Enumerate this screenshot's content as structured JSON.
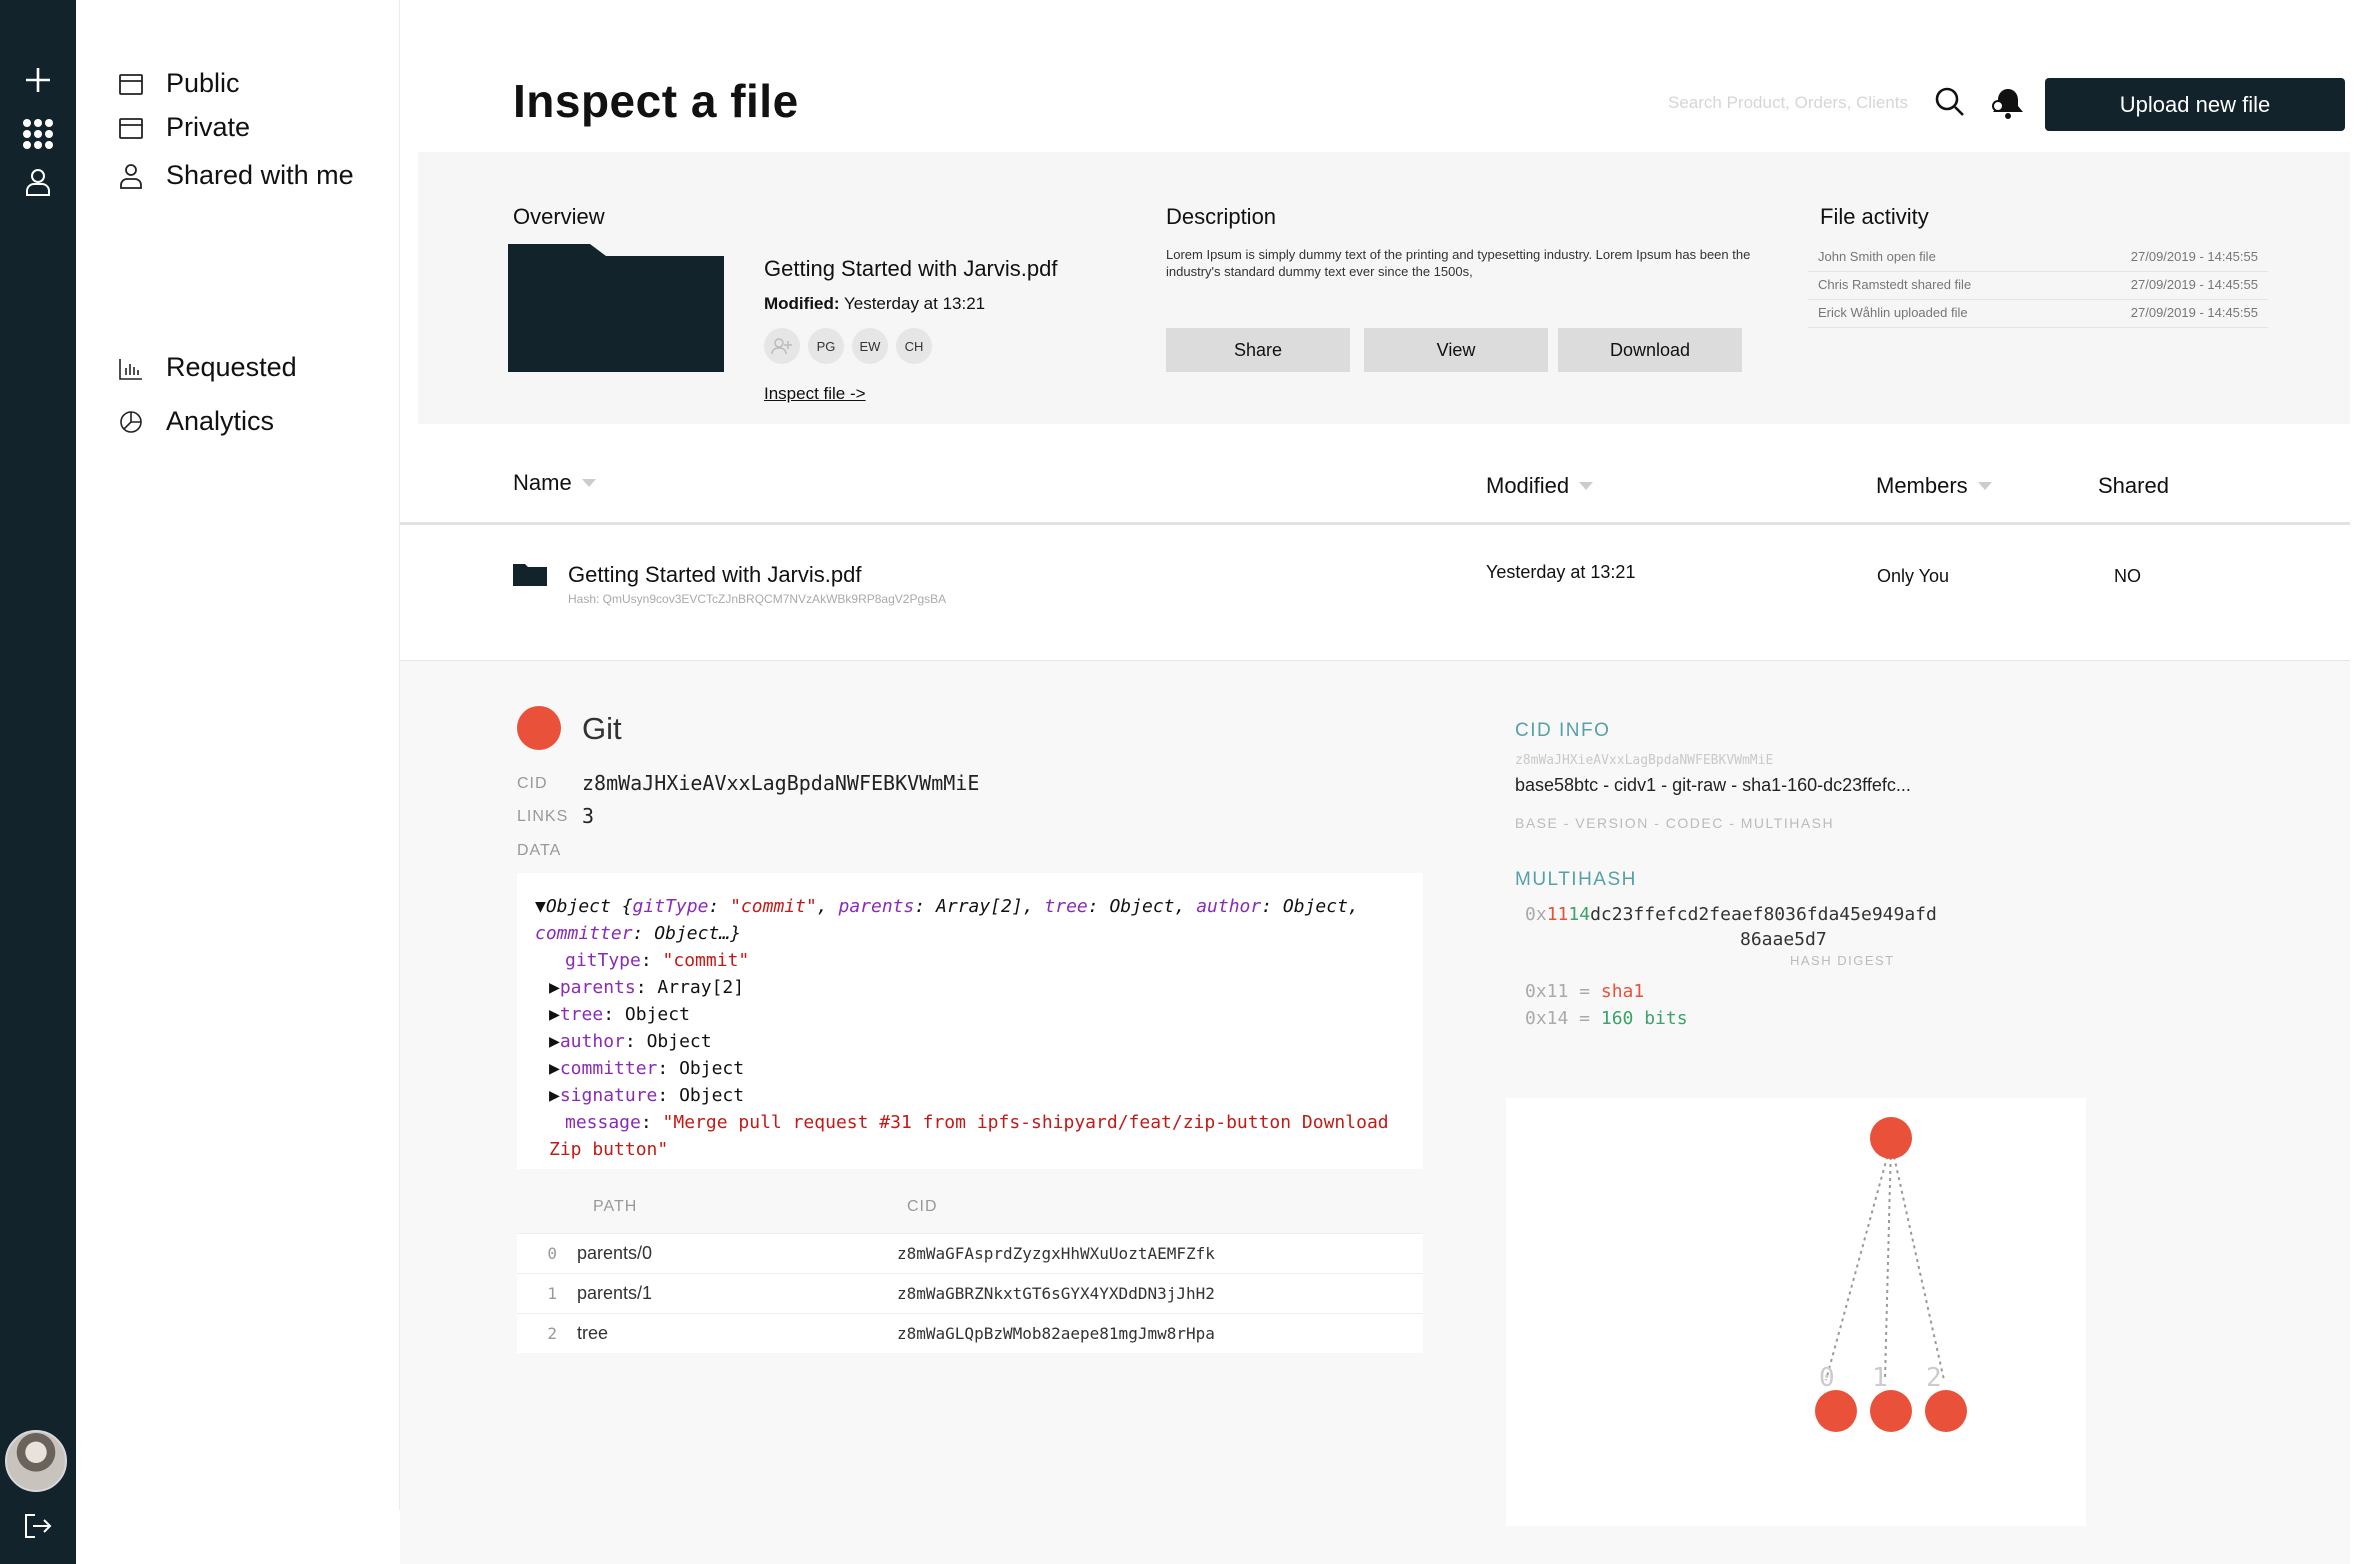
{
  "rail": {
    "icons": [
      "plus-icon",
      "apps-grid-icon",
      "user-icon",
      "logout-icon"
    ]
  },
  "sidebar": {
    "items": [
      {
        "label": "Public",
        "icon": "calendar-icon"
      },
      {
        "label": "Private",
        "icon": "calendar-icon"
      },
      {
        "label": "Shared with me",
        "icon": "user-icon"
      },
      {
        "label": "Requested",
        "icon": "bar-chart-icon"
      },
      {
        "label": "Analytics",
        "icon": "pie-chart-icon"
      }
    ]
  },
  "header": {
    "title": "Inspect a file",
    "search_placeholder": "Search Product, Orders, Clients",
    "upload_label": "Upload new file"
  },
  "overview": {
    "label": "Overview",
    "file_name": "Getting Started with Jarvis.pdf",
    "modified_key": "Modified:",
    "modified_value": "Yesterday at 13:21",
    "members": [
      "PG",
      "EW",
      "CH"
    ],
    "inspect_link": "Inspect file ->",
    "description_label": "Description",
    "description": "Lorem Ipsum is simply dummy text of the printing and typesetting industry. Lorem Ipsum has been the industry's standard dummy text ever since the 1500s,",
    "buttons": {
      "share": "Share",
      "view": "View",
      "download": "Download"
    },
    "activity_label": "File activity",
    "activity": [
      {
        "text": "John Smith open file",
        "time": "27/09/2019 - 14:45:55"
      },
      {
        "text": "Chris Ramstedt shared file",
        "time": "27/09/2019 - 14:45:55"
      },
      {
        "text": "Erick Wåhlin uploaded file",
        "time": "27/09/2019 - 14:45:55"
      }
    ]
  },
  "table": {
    "headers": {
      "name": "Name",
      "modified": "Modified",
      "members": "Members",
      "shared": "Shared"
    },
    "rows": [
      {
        "name": "Getting Started with Jarvis.pdf",
        "hash": "Hash: QmUsyn9cov3EVCTcZJnBRQCM7NVzAkWBk9RP8agV2PgsBA",
        "modified": "Yesterday at 13:21",
        "members": "Only You",
        "shared": "NO"
      }
    ]
  },
  "inspector": {
    "codec": "Git",
    "cid_key": "CID",
    "cid_value": "z8mWaJHXieAVxxLagBpdaNWFEBKVWmMiE",
    "links_key": "LINKS",
    "links_value": "3",
    "data_key": "DATA",
    "code": {
      "l1_pre": "▼Object {",
      "l1_k1": "gitType",
      "l1_v1": "\"commit\"",
      "l1_k2": "parents",
      "l1_v2": "Array[2]",
      "l1_k3": "tree",
      "l1_v3": "Object",
      "l1_k4": "author",
      "l1_v4": "Object,",
      "l2_k": "committer",
      "l2_v": "Object…}",
      "l3_k": "gitType",
      "l3_v": "\"commit\"",
      "l4_k": "parents",
      "l4_v": "Array[2]",
      "l5_k": "tree",
      "l5_v": "Object",
      "l6_k": "author",
      "l6_v": "Object",
      "l7_k": "committer",
      "l7_v": "Object",
      "l8_k": "signature",
      "l8_v": "Object",
      "l9_k": "message",
      "l9_v": "\"Merge pull request #31 from ipfs-shipyard/feat/zip-button Download",
      "l10_v": "Zip button\""
    },
    "links_table": {
      "headers": {
        "path": "PATH",
        "cid": "CID"
      },
      "rows": [
        {
          "idx": "0",
          "path": "parents/0",
          "cid": "z8mWaGFAsprdZyzgxHhWXuUoztAEMFZfk"
        },
        {
          "idx": "1",
          "path": "parents/1",
          "cid": "z8mWaGBRZNkxtGT6sGYX4YXDdDN3jJhH2"
        },
        {
          "idx": "2",
          "path": "tree",
          "cid": "z8mWaGLQpBzWMob82aepe81mgJmw8rHpa"
        }
      ]
    },
    "cid_info": {
      "heading": "CID INFO",
      "cid_small": "z8mWaJHXieAVxxLagBpdaNWFEBKVWmMiE",
      "summary": "base58btc - cidv1 - git-raw - sha1-160-dc23ffefc...",
      "caption": "BASE - VERSION - CODEC - MULTIHASH"
    },
    "multihash": {
      "heading": "MULTIHASH",
      "prefix": "0x",
      "code": "11",
      "length": "14",
      "digest_1": "dc23ffefcd2feaef8036fda45e949afd",
      "digest_2": "86aae5d7",
      "caption": "HASH DIGEST",
      "fn_prefix": "0x11 =",
      "fn_name": "sha1",
      "len_prefix": "0x14 =",
      "len_value": "160 bits"
    },
    "dag": {
      "labels": [
        "0",
        "1",
        "2"
      ]
    }
  },
  "colors": {
    "rail": "#13232c",
    "accent": "#e9513a",
    "teal": "#55a1a8",
    "green": "#3aa36a"
  }
}
